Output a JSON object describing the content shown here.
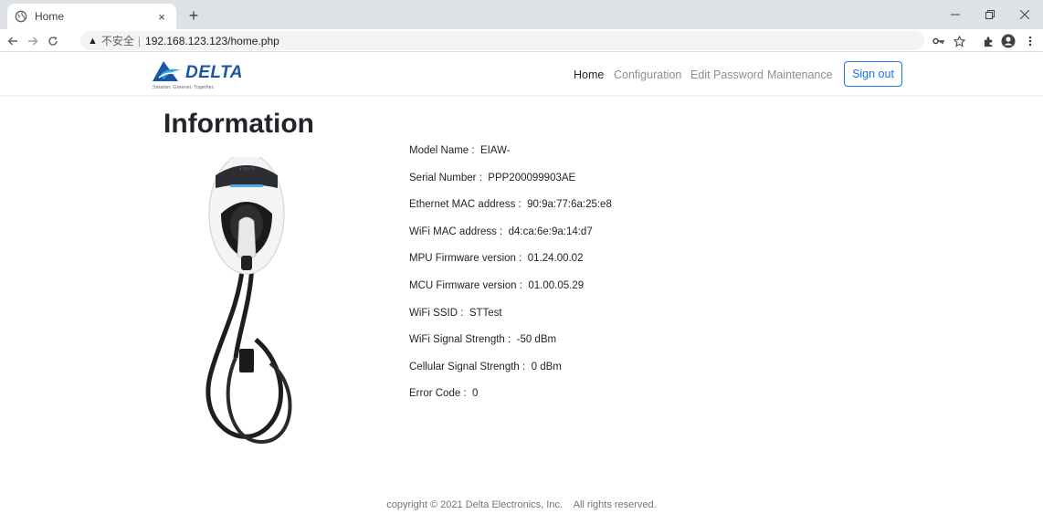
{
  "browser": {
    "tab_title": "Home",
    "tab_close": "×",
    "new_tab": "+",
    "url_warning": "▲",
    "url_insecure": "不安全",
    "url_separator": "|",
    "url": "192.168.123.123/home.php"
  },
  "site": {
    "logo_brand": "DELTA",
    "logo_tagline": "Smarter. Greener. Together.",
    "nav": [
      {
        "label": "Home",
        "active": true
      },
      {
        "label": "Configuration"
      },
      {
        "label": "Edit Password"
      },
      {
        "label": "Maintenance"
      }
    ],
    "signout_label": "Sign out",
    "accent_color": "#1a73e8",
    "brand_color": "#1a56a8"
  },
  "main": {
    "heading": "Information",
    "info": [
      {
        "label": "Model Name",
        "value": "EIAW-"
      },
      {
        "label": "Serial Number",
        "value": "PPP200099903AE"
      },
      {
        "label": "Ethernet MAC address",
        "value": "90:9a:77:6a:25:e8"
      },
      {
        "label": "WiFi MAC address",
        "value": "d4:ca:6e:9a:14:d7"
      },
      {
        "label": "MPU Firmware version",
        "value": "01.24.00.02"
      },
      {
        "label": "MCU Firmware version",
        "value": "01.00.05.29"
      },
      {
        "label": "WiFi SSID",
        "value": "STTest"
      },
      {
        "label": "WiFi Signal Strength",
        "value": "-50 dBm"
      },
      {
        "label": "Cellular Signal Strength",
        "value": "0 dBm"
      },
      {
        "label": "Error Code",
        "value": "0"
      }
    ]
  },
  "footer": {
    "text": "copyright © 2021 Delta Electronics, Inc.    All rights reserved."
  }
}
